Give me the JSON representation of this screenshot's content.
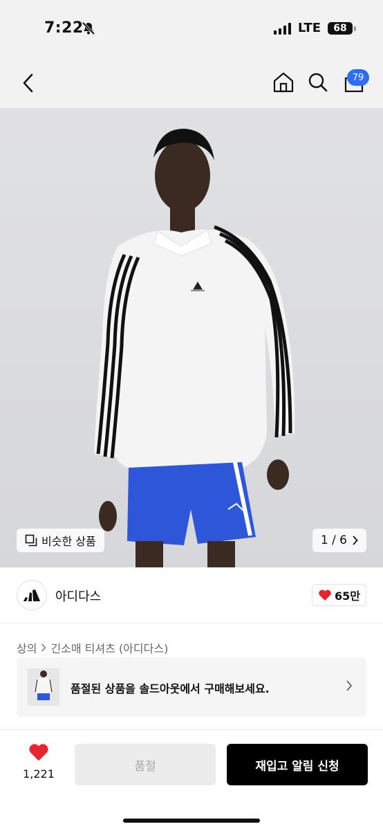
{
  "status_bar": {
    "time": "7:22",
    "network": "LTE",
    "battery": "68"
  },
  "header": {
    "cart_badge": "79"
  },
  "hero": {
    "similar_label": "비슷한 상품",
    "page_indicator": "1 / 6"
  },
  "brand": {
    "name": "아디다스",
    "likes": "65만"
  },
  "breadcrumb": {
    "category": "상의",
    "subcategory": "긴소매 티셔츠 (아디다스)"
  },
  "banner": {
    "text": "품절된 상품을 솔드아웃에서 구매해보세요."
  },
  "bottom_bar": {
    "wish_count": "1,221",
    "soldout_label": "품절",
    "restock_label": "재입고 알림 신청"
  },
  "colors": {
    "accent": "#2f6df6",
    "heart": "#e5262e",
    "primary_button": "#000000"
  }
}
